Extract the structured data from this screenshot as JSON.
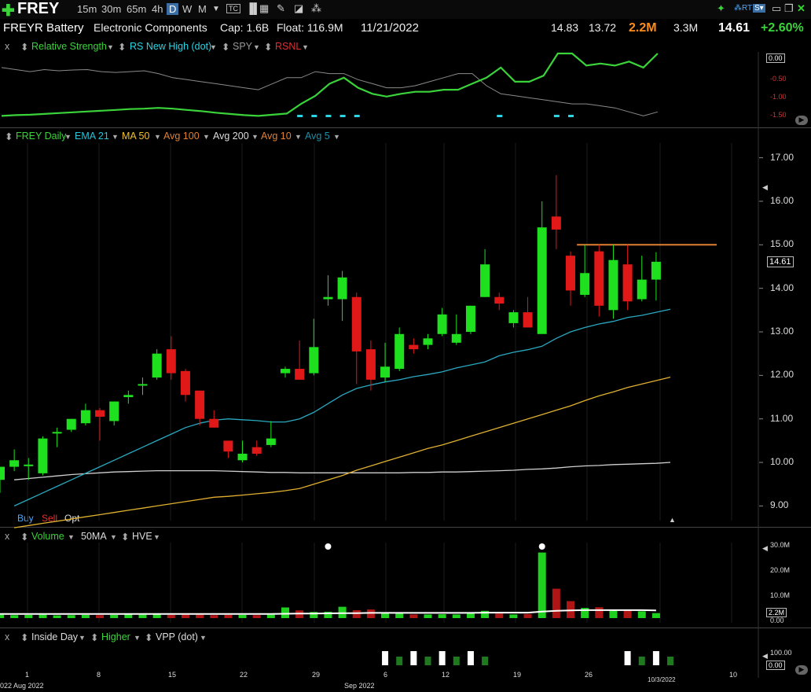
{
  "toolbar": {
    "symbol": "FREY",
    "timeframes": [
      "15m",
      "30m",
      "65m",
      "4h",
      "D",
      "W",
      "M"
    ],
    "selected_timeframe": "D"
  },
  "info": {
    "company": "FREYR Battery",
    "sector": "Electronic Components",
    "cap": "Cap: 1.6B",
    "float": "Float: 116.9M",
    "date": "11/21/2022",
    "high": "14.83",
    "low": "13.72",
    "volume": "2.2M",
    "avg_volume": "3.3M",
    "price": "14.61",
    "change": "+2.60%"
  },
  "rs_panel": {
    "close": "x",
    "labels": [
      "Relative Strength",
      "RS New High (dot)",
      "SPY",
      "RSNL"
    ],
    "colors": [
      "#3ad33a",
      "#29d6e6",
      "#999999",
      "#e03030"
    ],
    "axis": [
      "-0.50",
      "-1.00",
      "-1.50"
    ],
    "current": "0.00"
  },
  "price_panel": {
    "labels": [
      "FREY Daily",
      "EMA 21",
      "MA 50",
      "Avg 100",
      "Avg 200",
      "Avg 10",
      "Avg 5"
    ],
    "colors": [
      "#3ad33a",
      "#29c3d6",
      "#f0c030",
      "#e08030",
      "#dddddd",
      "#e08030",
      "#1a8fa8"
    ],
    "axis": [
      "17.00",
      "16.00",
      "15.00",
      "14.00",
      "13.00",
      "12.00",
      "11.00",
      "10.00",
      "9.00"
    ],
    "current_price": "14.61",
    "buy": "Buy",
    "sell": "Sell",
    "opt": "Opt"
  },
  "volume_panel": {
    "close": "x",
    "labels": [
      "Volume",
      "50MA",
      "HVE"
    ],
    "axis": [
      "30.0M",
      "20.0M",
      "10.0M",
      "0.00"
    ],
    "current": "2.2M"
  },
  "indicator_panel": {
    "close": "x",
    "labels": [
      "Inside Day",
      "Higher",
      "VPP (dot)"
    ],
    "axis_top": "100.00",
    "current": "0.00"
  },
  "date_axis": {
    "labels": [
      "1",
      "8",
      "15",
      "22",
      "29",
      "6",
      "12",
      "19",
      "26",
      "10"
    ],
    "month_labels": [
      "022 Aug 2022",
      "Sep 2022"
    ],
    "cursor_label": "10/3/2022"
  },
  "chart_data": {
    "type": "candlestick",
    "ylim": [
      8.7,
      17.3
    ],
    "candles": [
      {
        "o": 9.6,
        "h": 9.9,
        "l": 9.3,
        "c": 9.9
      },
      {
        "o": 9.9,
        "h": 10.3,
        "l": 9.8,
        "c": 10.05
      },
      {
        "o": 9.95,
        "h": 10.1,
        "l": 9.6,
        "c": 9.95
      },
      {
        "o": 9.75,
        "h": 10.6,
        "l": 9.7,
        "c": 10.55
      },
      {
        "o": 10.7,
        "h": 10.8,
        "l": 10.35,
        "c": 10.7
      },
      {
        "o": 10.75,
        "h": 11.0,
        "l": 10.7,
        "c": 11.0
      },
      {
        "o": 10.9,
        "h": 11.35,
        "l": 10.85,
        "c": 11.2
      },
      {
        "o": 11.2,
        "h": 11.25,
        "l": 10.5,
        "c": 11.05
      },
      {
        "o": 10.95,
        "h": 11.4,
        "l": 10.85,
        "c": 11.4
      },
      {
        "o": 11.5,
        "h": 11.65,
        "l": 11.35,
        "c": 11.55
      },
      {
        "o": 11.8,
        "h": 11.95,
        "l": 11.55,
        "c": 11.8
      },
      {
        "o": 11.95,
        "h": 12.6,
        "l": 11.9,
        "c": 12.5
      },
      {
        "o": 12.6,
        "h": 12.9,
        "l": 11.9,
        "c": 12.05
      },
      {
        "o": 12.1,
        "h": 12.15,
        "l": 11.4,
        "c": 11.55
      },
      {
        "o": 11.65,
        "h": 11.65,
        "l": 10.85,
        "c": 11.0
      },
      {
        "o": 11.0,
        "h": 11.2,
        "l": 10.8,
        "c": 10.8
      },
      {
        "o": 10.5,
        "h": 10.5,
        "l": 10.1,
        "c": 10.25
      },
      {
        "o": 10.05,
        "h": 10.5,
        "l": 10.0,
        "c": 10.2
      },
      {
        "o": 10.35,
        "h": 10.5,
        "l": 10.15,
        "c": 10.2
      },
      {
        "o": 10.4,
        "h": 10.95,
        "l": 10.35,
        "c": 10.55
      },
      {
        "o": 12.05,
        "h": 12.2,
        "l": 11.95,
        "c": 12.15
      },
      {
        "o": 12.15,
        "h": 12.8,
        "l": 11.95,
        "c": 11.9
      },
      {
        "o": 12.05,
        "h": 13.3,
        "l": 12.0,
        "c": 12.65
      },
      {
        "o": 13.75,
        "h": 14.3,
        "l": 13.6,
        "c": 13.8
      },
      {
        "o": 13.75,
        "h": 14.4,
        "l": 13.25,
        "c": 14.25
      },
      {
        "o": 13.8,
        "h": 13.9,
        "l": 11.8,
        "c": 12.55
      },
      {
        "o": 12.6,
        "h": 12.8,
        "l": 11.65,
        "c": 11.9
      },
      {
        "o": 11.95,
        "h": 12.75,
        "l": 11.85,
        "c": 12.2
      },
      {
        "o": 12.15,
        "h": 13.1,
        "l": 12.1,
        "c": 12.95
      },
      {
        "o": 12.7,
        "h": 12.85,
        "l": 12.5,
        "c": 12.6
      },
      {
        "o": 12.7,
        "h": 12.95,
        "l": 12.6,
        "c": 12.85
      },
      {
        "o": 12.95,
        "h": 13.55,
        "l": 12.9,
        "c": 13.4
      },
      {
        "o": 12.75,
        "h": 13.4,
        "l": 12.7,
        "c": 12.95
      },
      {
        "o": 13.0,
        "h": 13.6,
        "l": 12.95,
        "c": 13.6
      },
      {
        "o": 13.8,
        "h": 14.9,
        "l": 13.8,
        "c": 14.55
      },
      {
        "o": 13.8,
        "h": 13.9,
        "l": 13.5,
        "c": 13.65
      },
      {
        "o": 13.2,
        "h": 13.5,
        "l": 13.1,
        "c": 13.45
      },
      {
        "o": 13.45,
        "h": 13.8,
        "l": 13.1,
        "c": 13.1
      },
      {
        "o": 12.95,
        "h": 16.0,
        "l": 13.9,
        "c": 15.4
      },
      {
        "o": 15.65,
        "h": 16.6,
        "l": 14.9,
        "c": 15.35
      },
      {
        "o": 14.75,
        "h": 14.85,
        "l": 13.6,
        "c": 13.95
      },
      {
        "o": 13.85,
        "h": 15.0,
        "l": 13.8,
        "c": 14.35
      },
      {
        "o": 14.85,
        "h": 15.0,
        "l": 13.35,
        "c": 13.6
      },
      {
        "o": 13.5,
        "h": 15.0,
        "l": 13.3,
        "c": 14.65
      },
      {
        "o": 14.55,
        "h": 15.0,
        "l": 13.5,
        "c": 13.7
      },
      {
        "o": 13.75,
        "h": 14.75,
        "l": 13.7,
        "c": 14.2
      },
      {
        "o": 14.2,
        "h": 14.83,
        "l": 13.72,
        "c": 14.61
      }
    ],
    "ema21": [
      9.0,
      9.15,
      9.3,
      9.45,
      9.6,
      9.75,
      9.9,
      10.05,
      10.2,
      10.35,
      10.5,
      10.65,
      10.8,
      10.9,
      10.97,
      11.0,
      10.98,
      10.96,
      10.93,
      10.93,
      11.0,
      11.15,
      11.35,
      11.55,
      11.7,
      11.78,
      11.85,
      11.9,
      11.97,
      12.02,
      12.08,
      12.17,
      12.24,
      12.31,
      12.45,
      12.53,
      12.59,
      12.67,
      12.85,
      13.0,
      13.1,
      13.18,
      13.24,
      13.33,
      13.38,
      13.45,
      13.52
    ],
    "ma50": [
      8.5,
      8.55,
      8.6,
      8.65,
      8.7,
      8.75,
      8.8,
      8.85,
      8.9,
      8.95,
      9.0,
      9.05,
      9.1,
      9.15,
      9.2,
      9.22,
      9.25,
      9.28,
      9.31,
      9.35,
      9.4,
      9.5,
      9.6,
      9.7,
      9.82,
      9.92,
      10.02,
      10.12,
      10.22,
      10.32,
      10.4,
      10.5,
      10.6,
      10.7,
      10.8,
      10.9,
      11.0,
      11.1,
      11.2,
      11.3,
      11.42,
      11.53,
      11.62,
      11.72,
      11.8,
      11.88,
      11.96
    ],
    "ma200": [
      9.6,
      9.63,
      9.66,
      9.69,
      9.72,
      9.74,
      9.76,
      9.78,
      9.79,
      9.8,
      9.81,
      9.81,
      9.81,
      9.81,
      9.81,
      9.8,
      9.79,
      9.78,
      9.77,
      9.77,
      9.76,
      9.76,
      9.76,
      9.76,
      9.76,
      9.76,
      9.76,
      9.76,
      9.77,
      9.77,
      9.78,
      9.78,
      9.79,
      9.8,
      9.81,
      9.82,
      9.84,
      9.85,
      9.87,
      9.9,
      9.92,
      9.93,
      9.95,
      9.96,
      9.97,
      9.98,
      10.0
    ],
    "resistance": {
      "from": 41,
      "to": 50,
      "value": 15.0
    },
    "volume": [
      1.5,
      1.3,
      1.4,
      1.5,
      1.2,
      1.3,
      1.4,
      1.3,
      1.4,
      1.6,
      1.5,
      2.0,
      1.4,
      1.5,
      1.5,
      1.3,
      1.4,
      1.4,
      1.3,
      1.5,
      4.7,
      3.4,
      2.7,
      2.8,
      5.0,
      3.5,
      3.8,
      2.6,
      2.6,
      1.6,
      1.6,
      1.7,
      1.6,
      2.1,
      3.2,
      2.0,
      1.6,
      1.8,
      29.0,
      13.0,
      7.5,
      4.5,
      4.8,
      3.5,
      3.3,
      3.0,
      2.2
    ],
    "vol_ma": [
      1.8,
      1.8,
      1.8,
      1.8,
      1.8,
      1.8,
      1.8,
      1.8,
      1.8,
      1.8,
      1.8,
      1.8,
      1.8,
      1.8,
      1.8,
      1.8,
      1.8,
      1.8,
      1.8,
      1.8,
      1.9,
      2.0,
      2.0,
      2.1,
      2.2,
      2.2,
      2.3,
      2.3,
      2.3,
      2.3,
      2.3,
      2.3,
      2.3,
      2.3,
      2.4,
      2.4,
      2.4,
      2.4,
      2.9,
      3.2,
      3.4,
      3.5,
      3.5,
      3.5,
      3.5,
      3.5,
      3.4
    ],
    "volume_ylim": [
      0,
      32
    ],
    "rs": [
      -1.5,
      -1.48,
      -1.47,
      -1.45,
      -1.43,
      -1.41,
      -1.39,
      -1.37,
      -1.35,
      -1.33,
      -1.32,
      -1.3,
      -1.32,
      -1.35,
      -1.38,
      -1.42,
      -1.45,
      -1.48,
      -1.5,
      -1.47,
      -1.44,
      -1.2,
      -1.0,
      -0.7,
      -0.55,
      -0.8,
      -0.95,
      -1.02,
      -0.95,
      -0.9,
      -0.9,
      -0.85,
      -0.85,
      -0.7,
      -0.55,
      -0.3,
      -0.65,
      -0.65,
      -0.5,
      0.05,
      0.05,
      -0.25,
      -0.2,
      -0.25,
      -0.15,
      -0.3,
      0.05
    ],
    "spy": [
      -0.3,
      -0.35,
      -0.4,
      -0.35,
      -0.38,
      -0.36,
      -0.35,
      -0.4,
      -0.42,
      -0.4,
      -0.38,
      -0.45,
      -0.55,
      -0.6,
      -0.65,
      -0.7,
      -0.75,
      -0.8,
      -0.85,
      -0.7,
      -0.55,
      -0.55,
      -0.4,
      -0.45,
      -0.45,
      -0.6,
      -0.7,
      -0.8,
      -0.8,
      -0.75,
      -0.65,
      -0.55,
      -0.45,
      -0.45,
      -0.75,
      -0.95,
      -1.0,
      -1.05,
      -1.1,
      -1.15,
      -1.2,
      -1.2,
      -1.25,
      -1.3,
      -1.4,
      -1.5,
      -1.4
    ],
    "rs_dots": [
      21,
      22,
      23,
      24,
      25,
      35,
      39,
      40
    ],
    "inside_day": [
      27,
      29,
      31,
      33,
      44,
      46
    ],
    "higher": [
      28,
      30,
      32,
      34,
      45,
      47
    ]
  }
}
